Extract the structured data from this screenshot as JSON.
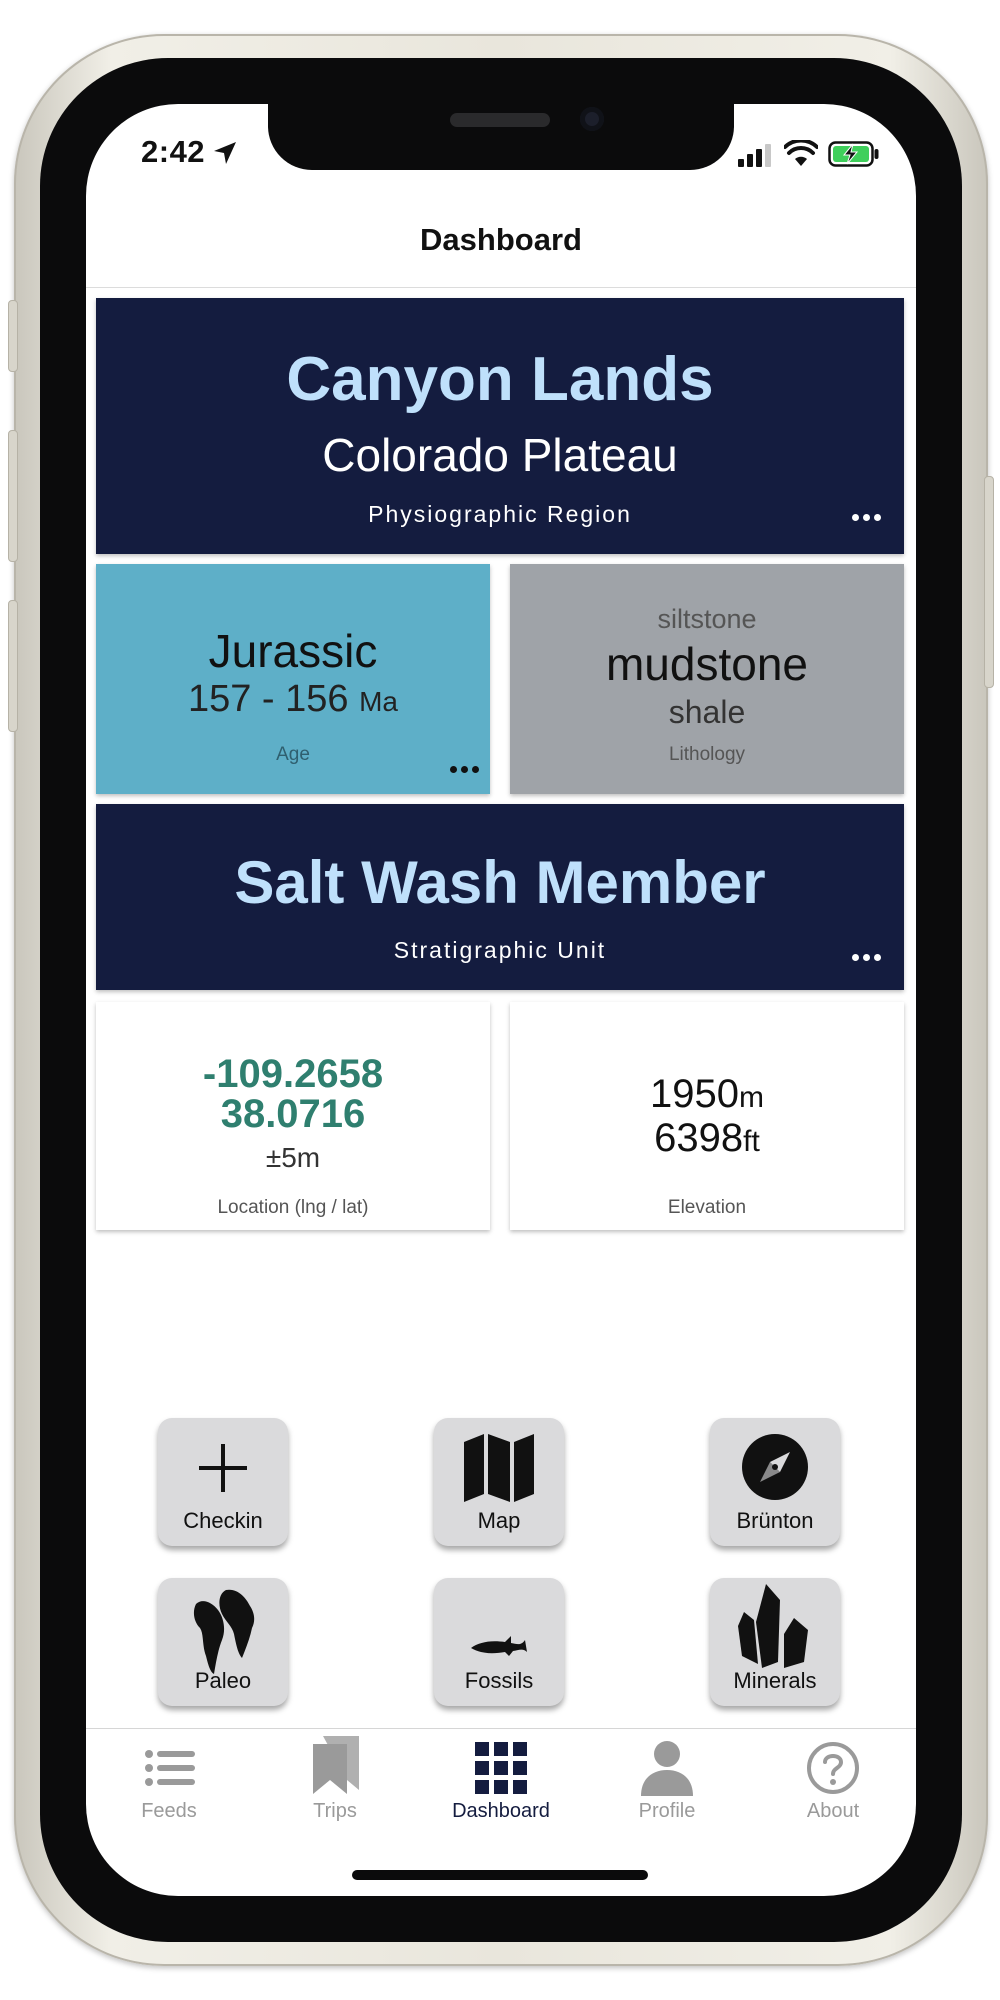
{
  "status_bar": {
    "time": "2:42"
  },
  "nav": {
    "title": "Dashboard"
  },
  "region_card": {
    "title": "Canyon Lands",
    "subtitle": "Colorado Plateau",
    "caption": "Physiographic Region"
  },
  "age_card": {
    "period": "Jurassic",
    "range": "157 - 156",
    "unit": "Ma",
    "caption": "Age",
    "color": "#5eafc8"
  },
  "lithology_card": {
    "top": "siltstone",
    "main": "mudstone",
    "bottom": "shale",
    "caption": "Lithology",
    "color": "#9fa3a8"
  },
  "unit_card": {
    "title": "Salt Wash Member",
    "caption": "Stratigraphic Unit"
  },
  "location_card": {
    "lng": "-109.2658",
    "lat": "38.0716",
    "accuracy": "±5m",
    "caption": "Location (lng / lat)",
    "color": "#2f7f6f"
  },
  "elevation_card": {
    "meters": "1950",
    "meters_unit": "m",
    "feet": "6398",
    "feet_unit": "ft",
    "caption": "Elevation"
  },
  "actions": [
    {
      "label": "Checkin",
      "icon": "plus-icon"
    },
    {
      "label": "Map",
      "icon": "map-icon"
    },
    {
      "label": "Brünton",
      "icon": "compass-icon"
    },
    {
      "label": "Paleo",
      "icon": "continents-icon"
    },
    {
      "label": "Fossils",
      "icon": "fish-fossil-icon"
    },
    {
      "label": "Minerals",
      "icon": "crystals-icon"
    }
  ],
  "tabs": [
    {
      "label": "Feeds",
      "icon": "list-icon",
      "active": false
    },
    {
      "label": "Trips",
      "icon": "bookmarks-icon",
      "active": false
    },
    {
      "label": "Dashboard",
      "icon": "grid-icon",
      "active": true
    },
    {
      "label": "Profile",
      "icon": "person-icon",
      "active": false
    },
    {
      "label": "About",
      "icon": "question-icon",
      "active": false
    }
  ],
  "colors": {
    "navy": "#141c3f",
    "accent_light": "#bfe0fb",
    "tab_active": "#141c3f",
    "tab_inactive": "#9a9a9a"
  }
}
